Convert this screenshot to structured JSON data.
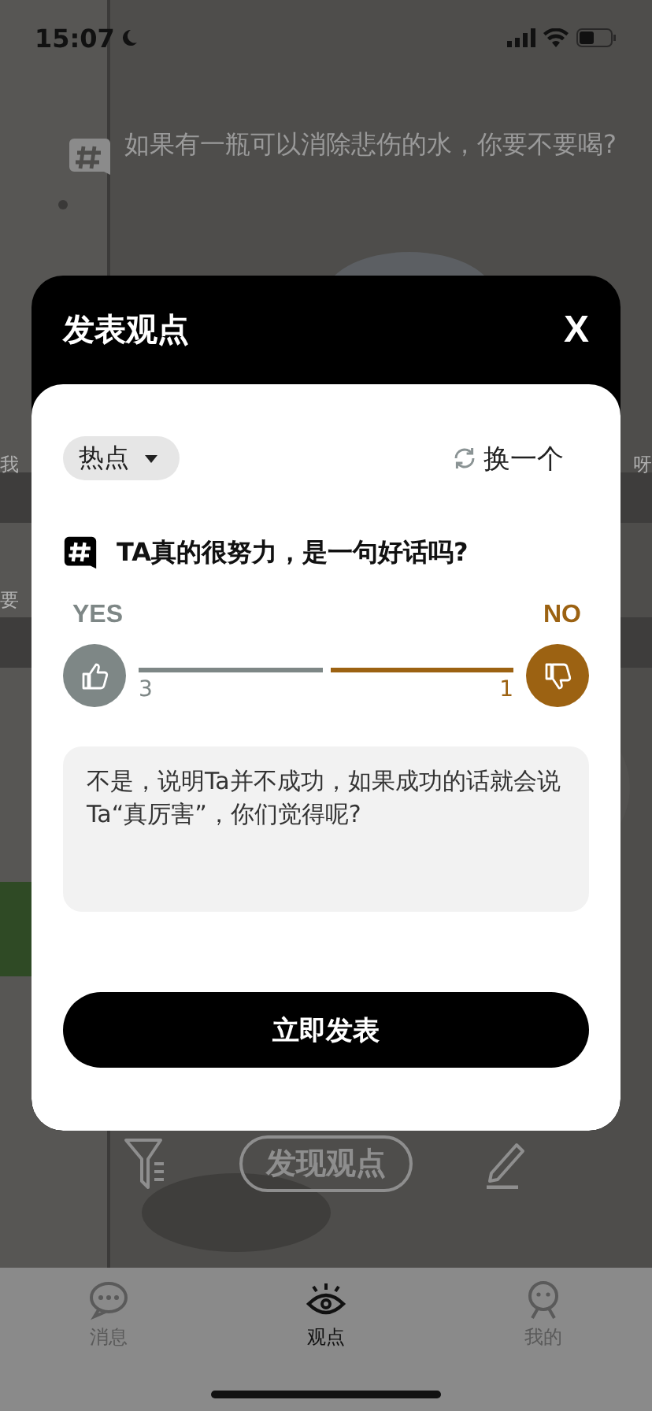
{
  "status_bar": {
    "time": "15:07"
  },
  "background": {
    "question": "如果有一瓶可以消除悲伤的水，你要不要喝?",
    "fragment_rows": [
      {
        "left": "我",
        "right": "呀"
      },
      {
        "left": "要"
      }
    ],
    "discover_button": "发现观点"
  },
  "modal": {
    "title": "发表观点",
    "close": "X",
    "category": "热点",
    "refresh": "换一个",
    "question": "TA真的很努力，是一句好话吗?",
    "sides": [
      {
        "label": "YES",
        "count": "3",
        "color": "#7e8786"
      },
      {
        "label": "NO",
        "count": "1",
        "color": "#9c6212"
      }
    ],
    "answer": "不是，说明Ta并不成功，如果成功的话就会说Ta“真厉害”，你们觉得呢?",
    "submit": "立即发表"
  },
  "tabs": [
    {
      "label": "消息",
      "selected": false
    },
    {
      "label": "观点",
      "selected": true
    },
    {
      "label": "我的",
      "selected": false
    }
  ]
}
